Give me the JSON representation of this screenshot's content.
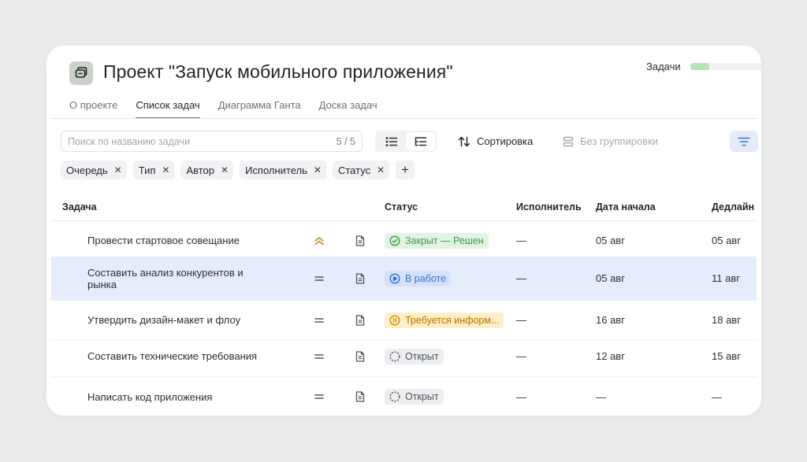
{
  "project": {
    "title": "Проект \"Запуск мобильного приложения\""
  },
  "progress": {
    "label": "Задачи",
    "fraction": 0.27,
    "fill_color": "#b8e3b7"
  },
  "tabs": [
    {
      "label": "О проекте",
      "active": false
    },
    {
      "label": "Список задач",
      "active": true
    },
    {
      "label": "Диаграмма Ганта",
      "active": false
    },
    {
      "label": "Доска задач",
      "active": false
    }
  ],
  "toolbar": {
    "search_placeholder": "Поиск по названию задачи",
    "search_count": "5 / 5",
    "sort_label": "Сортировка",
    "group_label": "Без группировки"
  },
  "filters": [
    {
      "label": "Очередь"
    },
    {
      "label": "Тип"
    },
    {
      "label": "Автор"
    },
    {
      "label": "Исполнитель"
    },
    {
      "label": "Статус"
    }
  ],
  "table": {
    "columns": {
      "task": "Задача",
      "status": "Статус",
      "assignee": "Исполнитель",
      "start": "Дата начала",
      "deadline": "Дедлайн"
    },
    "rows": [
      {
        "task": "Провести стартовое совещание",
        "priority": "high-priority-icon",
        "status": "Закрыт — Решен",
        "status_kind": "closed",
        "assignee": "—",
        "start": "05 авг",
        "deadline": "05 авг"
      },
      {
        "task": "Составить анализ конкурентов и рынка",
        "priority": "normal-priority-icon",
        "status": "В работе",
        "status_kind": "inwork",
        "assignee": "—",
        "start": "05 авг",
        "deadline": "11 авг"
      },
      {
        "task": "Утвердить дизайн-макет и флоу",
        "priority": "normal-priority-icon",
        "status": "Требуется информ...",
        "status_kind": "needinfo",
        "assignee": "—",
        "start": "16 авг",
        "deadline": "18 авг"
      },
      {
        "task": "Составить технические требования",
        "priority": "normal-priority-icon",
        "status": "Открыт",
        "status_kind": "open",
        "assignee": "—",
        "start": "12 авг",
        "deadline": "15 авг"
      },
      {
        "task": "Написать код приложения",
        "priority": "normal-priority-icon",
        "status": "Открыт",
        "status_kind": "open",
        "assignee": "—",
        "start": "—",
        "deadline": "—"
      }
    ]
  },
  "colors": {
    "accent": "#3f7ad9",
    "selected_row": "#e5edfc",
    "closed": "#3c9a46",
    "inwork": "#3770d1",
    "needinfo": "#b66d00",
    "open": "#50555c",
    "high_priority": "#c98a1c"
  }
}
